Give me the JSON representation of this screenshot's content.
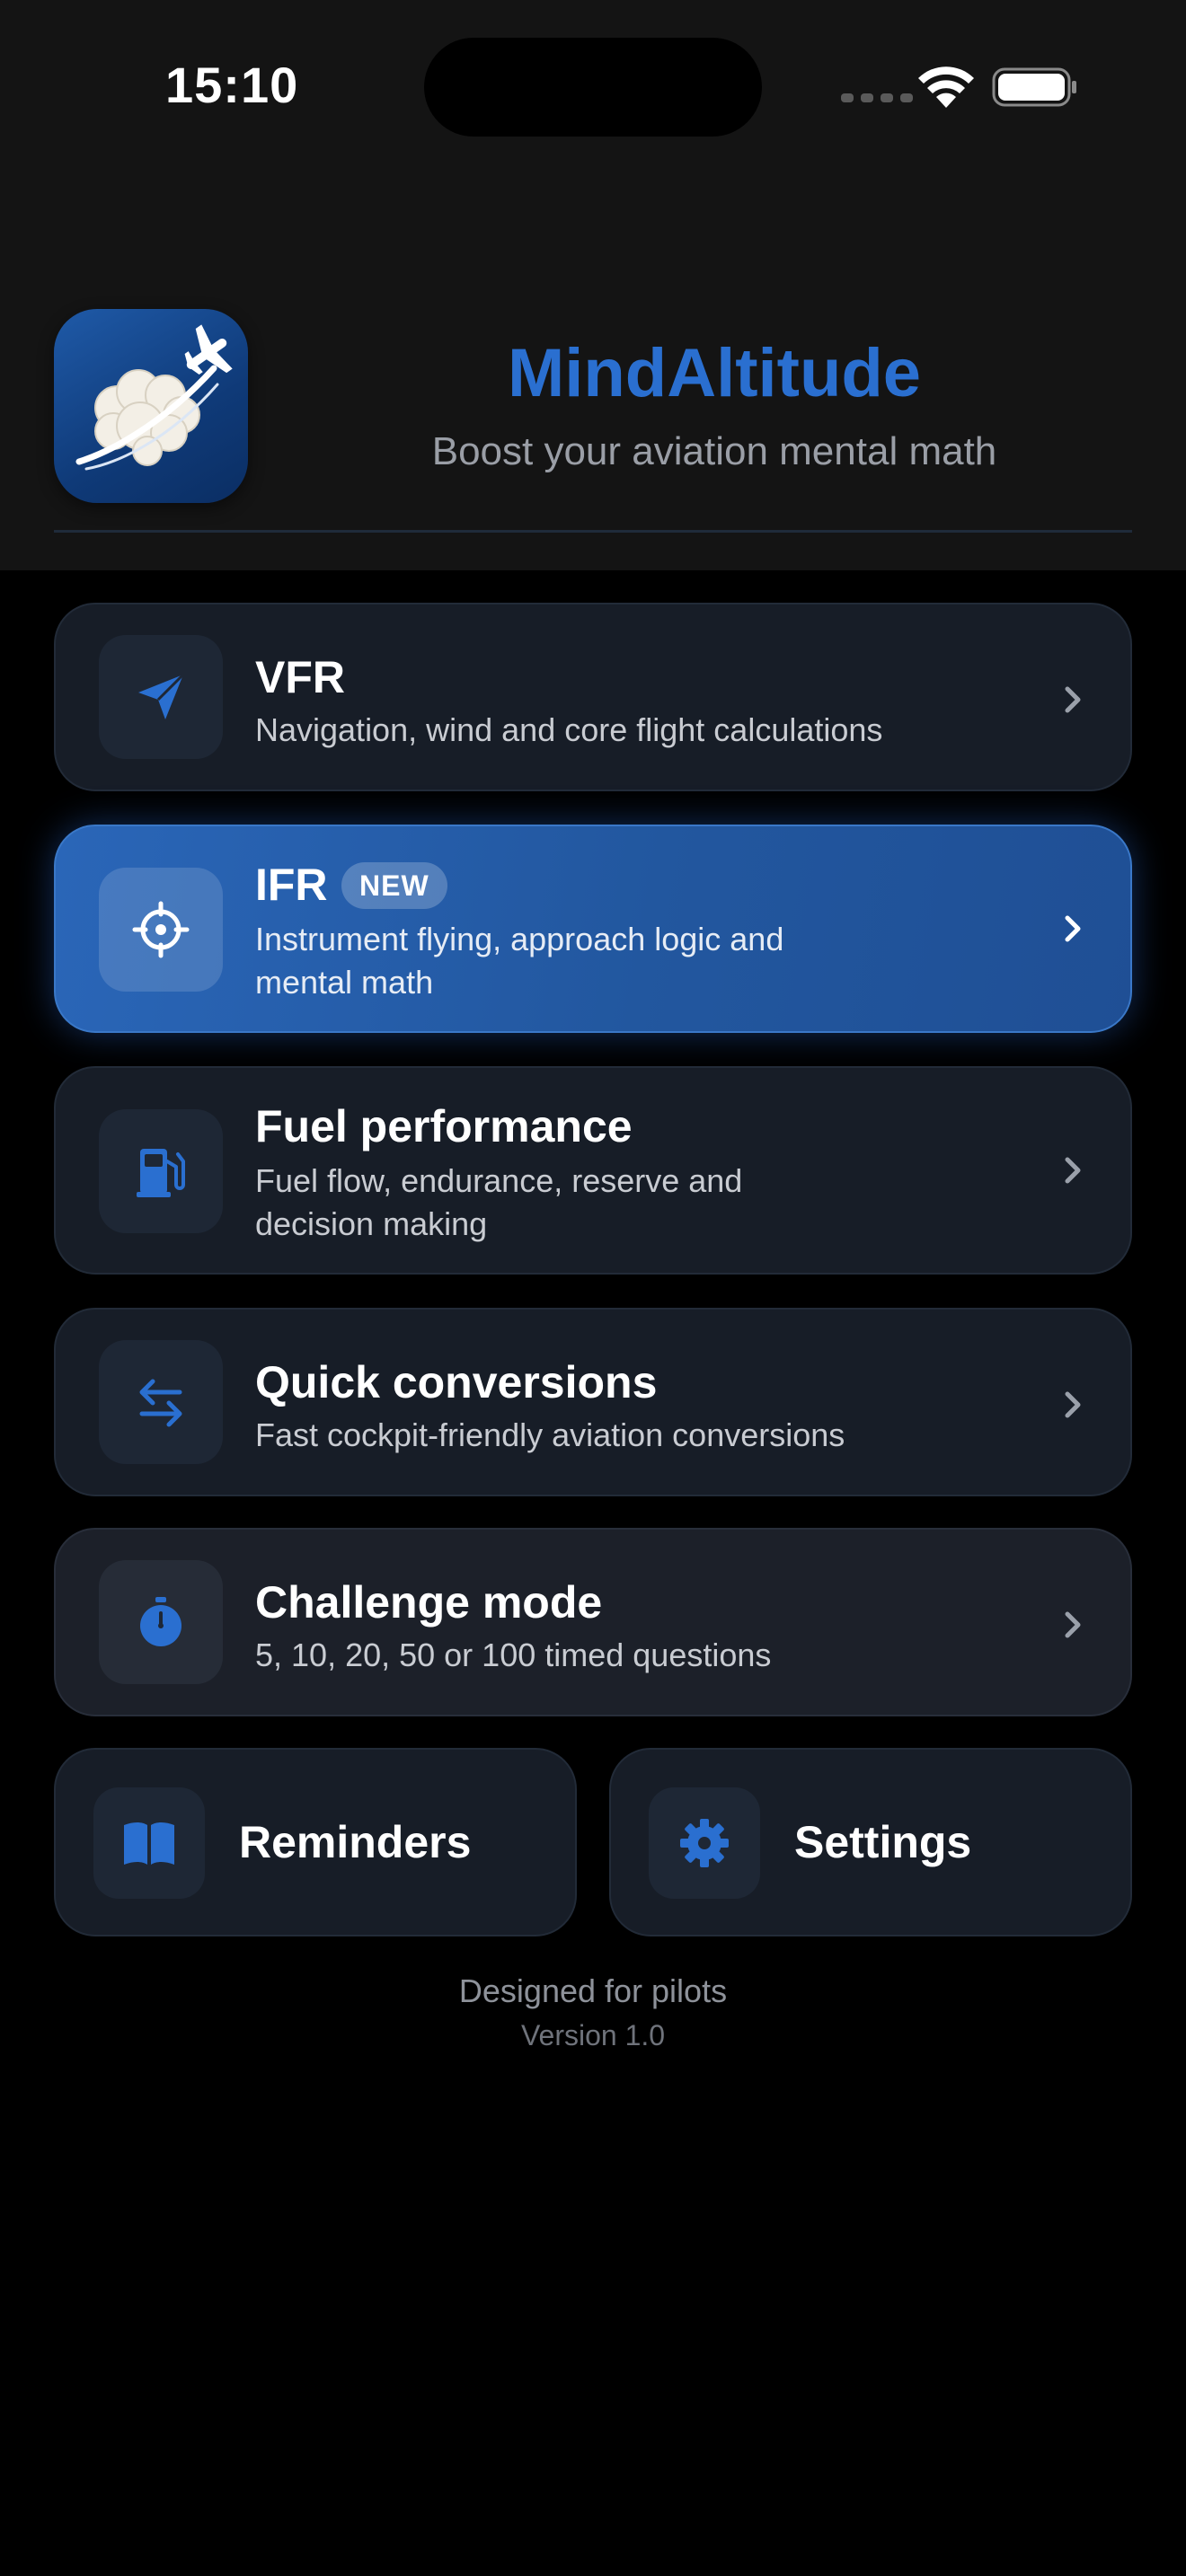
{
  "status_bar": {
    "time": "15:10"
  },
  "header": {
    "app_name": "MindAltitude",
    "tagline": "Boost your aviation mental math",
    "logo_icon": "brain-airplane-logo"
  },
  "colors": {
    "background": "#000000",
    "header_background": "#141414",
    "accent": "#2a6fd0",
    "card_background": "#171d27",
    "highlight_card": "#2a66b8"
  },
  "menu": [
    {
      "id": "vfr",
      "title": "VFR",
      "description": "Navigation, wind and core flight calculations",
      "icon": "paper-plane-icon"
    },
    {
      "id": "ifr",
      "title": "IFR",
      "badge": "NEW",
      "description_line1": "Instrument flying, approach logic and",
      "description_line2": "mental math",
      "icon": "crosshair-icon"
    },
    {
      "id": "fuel",
      "title": "Fuel performance",
      "description_line1": "Fuel flow, endurance, reserve and",
      "description_line2": "decision making",
      "icon": "fuel-pump-icon"
    },
    {
      "id": "conversions",
      "title": "Quick conversions",
      "description": "Fast cockpit-friendly aviation conversions",
      "icon": "swap-arrows-icon"
    },
    {
      "id": "challenge",
      "title": "Challenge mode",
      "description": "5, 10, 20, 50 or 100 timed questions",
      "icon": "stopwatch-icon"
    }
  ],
  "bottom_buttons": {
    "reminders": {
      "label": "Reminders",
      "icon": "book-icon"
    },
    "settings": {
      "label": "Settings",
      "icon": "gear-icon"
    }
  },
  "footer": {
    "line1": "Designed for pilots",
    "line2": "Version 1.0"
  }
}
